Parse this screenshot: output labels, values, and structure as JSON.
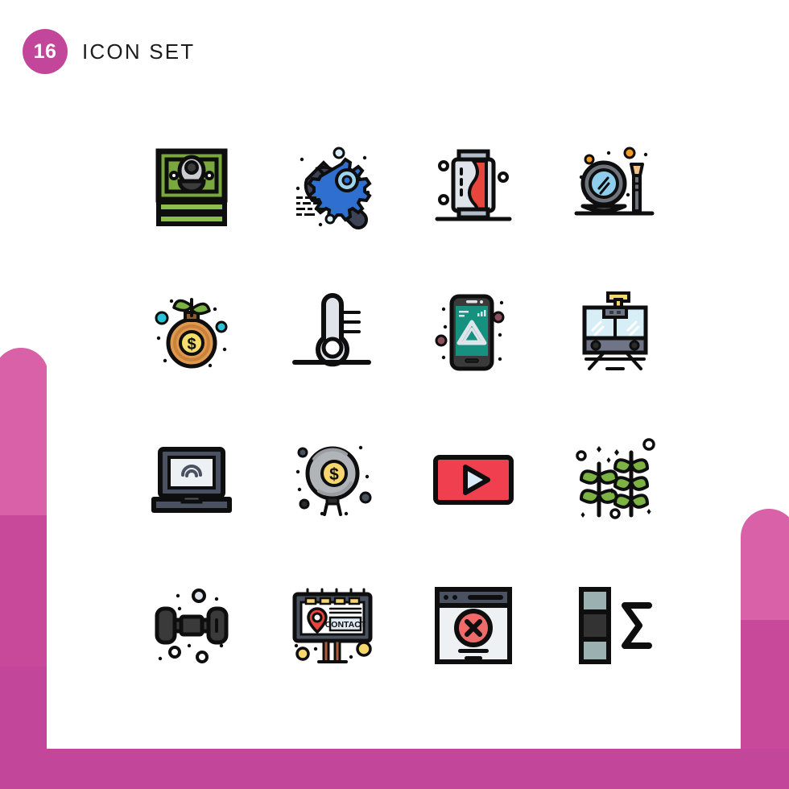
{
  "header": {
    "badge_count": "16",
    "title": "ICON SET"
  },
  "theme": {
    "accent_pink": "#c2479a",
    "accent_pink_light": "#d861a8",
    "background": "#ffffff",
    "outline": "#0e0e0e"
  },
  "grid": {
    "columns": 4,
    "rows": 4,
    "total_icons": 16
  },
  "icons": [
    {
      "index": 1,
      "name": "money-cash-stack",
      "label": "Money",
      "row": 1,
      "col": 1,
      "colors": [
        "#7aa83f",
        "#8cbd4d",
        "#c9cdd1",
        "#3b3b3b",
        "#0e0e0e"
      ]
    },
    {
      "index": 2,
      "name": "wrench-gear-settings",
      "label": "Settings",
      "row": 1,
      "col": 2,
      "colors": [
        "#3d4354",
        "#2f6fd0",
        "#9fd4ef",
        "#0e0e0e"
      ]
    },
    {
      "index": 3,
      "name": "soda-can-drink",
      "label": "Soda Can",
      "row": 1,
      "col": 3,
      "colors": [
        "#dfe3ea",
        "#b3bccb",
        "#e8453c",
        "#0e0e0e"
      ]
    },
    {
      "index": 4,
      "name": "mirror-makeup-brush",
      "label": "Mirror",
      "row": 1,
      "col": 4,
      "colors": [
        "#6f747c",
        "#8fcdec",
        "#f2c187",
        "#f59c1f",
        "#0e0e0e"
      ]
    },
    {
      "index": 5,
      "name": "money-plant-growth",
      "label": "Investment",
      "row": 2,
      "col": 1,
      "colors": [
        "#e09a4e",
        "#c9813c",
        "#f3dd6b",
        "#7cb342",
        "#29c2d6",
        "#0e0e0e"
      ]
    },
    {
      "index": 6,
      "name": "thermometer-temperature",
      "label": "Temperature",
      "row": 2,
      "col": 2,
      "colors": [
        "#dfe3ea",
        "#0e0e0e"
      ]
    },
    {
      "index": 7,
      "name": "mobile-app-triangle",
      "label": "Mobile App",
      "row": 2,
      "col": 3,
      "colors": [
        "#3a3a3a",
        "#17917f",
        "#dfe3ea",
        "#8c4f5e",
        "#0e0e0e"
      ]
    },
    {
      "index": 8,
      "name": "tram-train-transport",
      "label": "Tram",
      "row": 2,
      "col": 4,
      "colors": [
        "#d7eef6",
        "#6f7486",
        "#f5d76e",
        "#0e0e0e"
      ]
    },
    {
      "index": 9,
      "name": "laptop-wifi-signal",
      "label": "Laptop Wifi",
      "row": 3,
      "col": 1,
      "colors": [
        "#4a5160",
        "#eef1f3",
        "#0e0e0e"
      ]
    },
    {
      "index": 10,
      "name": "money-balloon-coin",
      "label": "Money Balloon",
      "row": 3,
      "col": 2,
      "colors": [
        "#b0b3b8",
        "#9a9da2",
        "#f5d76e",
        "#0e0e0e"
      ]
    },
    {
      "index": 11,
      "name": "video-play-button",
      "label": "Video",
      "row": 3,
      "col": 3,
      "colors": [
        "#f0404f",
        "#d9ecf7",
        "#0e0e0e"
      ]
    },
    {
      "index": 12,
      "name": "plants-crops-farm",
      "label": "Crops",
      "row": 3,
      "col": 4,
      "colors": [
        "#7cb342",
        "#0e0e0e"
      ]
    },
    {
      "index": 13,
      "name": "dumbbell-gym-weight",
      "label": "Dumbbell",
      "row": 4,
      "col": 1,
      "colors": [
        "#3a3a3a",
        "#dfe3ea",
        "#0e0e0e"
      ]
    },
    {
      "index": 14,
      "name": "billboard-contact-sign",
      "label": "Billboard",
      "row": 4,
      "col": 2,
      "colors": [
        "#4a5160",
        "#f5d76e",
        "#e8453c",
        "#b05c3b",
        "#dfeaf5",
        "#0e0e0e"
      ],
      "text": "CONTACT"
    },
    {
      "index": 15,
      "name": "browser-error-window",
      "label": "Error",
      "row": 4,
      "col": 3,
      "colors": [
        "#4a5160",
        "#eef1f3",
        "#ef6a6a",
        "#0e0e0e"
      ]
    },
    {
      "index": 16,
      "name": "sum-sigma-column",
      "label": "Sum",
      "row": 4,
      "col": 4,
      "colors": [
        "#9bb0b0",
        "#333333",
        "#0e0e0e"
      ]
    }
  ]
}
